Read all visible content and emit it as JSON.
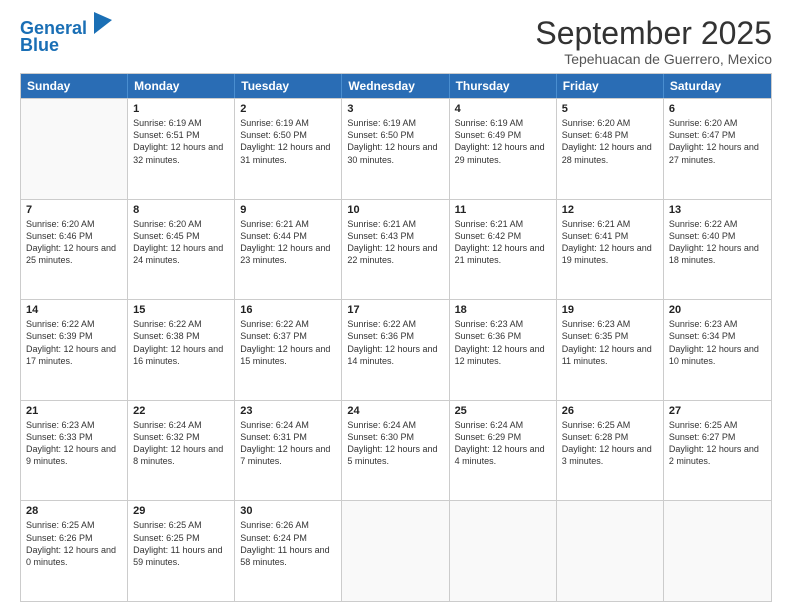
{
  "logo": {
    "line1": "General",
    "line2": "Blue"
  },
  "title": "September 2025",
  "subtitle": "Tepehuacan de Guerrero, Mexico",
  "headers": [
    "Sunday",
    "Monday",
    "Tuesday",
    "Wednesday",
    "Thursday",
    "Friday",
    "Saturday"
  ],
  "weeks": [
    [
      {
        "day": "",
        "sunrise": "",
        "sunset": "",
        "daylight": "",
        "empty": true
      },
      {
        "day": "1",
        "sunrise": "Sunrise: 6:19 AM",
        "sunset": "Sunset: 6:51 PM",
        "daylight": "Daylight: 12 hours and 32 minutes."
      },
      {
        "day": "2",
        "sunrise": "Sunrise: 6:19 AM",
        "sunset": "Sunset: 6:50 PM",
        "daylight": "Daylight: 12 hours and 31 minutes."
      },
      {
        "day": "3",
        "sunrise": "Sunrise: 6:19 AM",
        "sunset": "Sunset: 6:50 PM",
        "daylight": "Daylight: 12 hours and 30 minutes."
      },
      {
        "day": "4",
        "sunrise": "Sunrise: 6:19 AM",
        "sunset": "Sunset: 6:49 PM",
        "daylight": "Daylight: 12 hours and 29 minutes."
      },
      {
        "day": "5",
        "sunrise": "Sunrise: 6:20 AM",
        "sunset": "Sunset: 6:48 PM",
        "daylight": "Daylight: 12 hours and 28 minutes."
      },
      {
        "day": "6",
        "sunrise": "Sunrise: 6:20 AM",
        "sunset": "Sunset: 6:47 PM",
        "daylight": "Daylight: 12 hours and 27 minutes."
      }
    ],
    [
      {
        "day": "7",
        "sunrise": "Sunrise: 6:20 AM",
        "sunset": "Sunset: 6:46 PM",
        "daylight": "Daylight: 12 hours and 25 minutes."
      },
      {
        "day": "8",
        "sunrise": "Sunrise: 6:20 AM",
        "sunset": "Sunset: 6:45 PM",
        "daylight": "Daylight: 12 hours and 24 minutes."
      },
      {
        "day": "9",
        "sunrise": "Sunrise: 6:21 AM",
        "sunset": "Sunset: 6:44 PM",
        "daylight": "Daylight: 12 hours and 23 minutes."
      },
      {
        "day": "10",
        "sunrise": "Sunrise: 6:21 AM",
        "sunset": "Sunset: 6:43 PM",
        "daylight": "Daylight: 12 hours and 22 minutes."
      },
      {
        "day": "11",
        "sunrise": "Sunrise: 6:21 AM",
        "sunset": "Sunset: 6:42 PM",
        "daylight": "Daylight: 12 hours and 21 minutes."
      },
      {
        "day": "12",
        "sunrise": "Sunrise: 6:21 AM",
        "sunset": "Sunset: 6:41 PM",
        "daylight": "Daylight: 12 hours and 19 minutes."
      },
      {
        "day": "13",
        "sunrise": "Sunrise: 6:22 AM",
        "sunset": "Sunset: 6:40 PM",
        "daylight": "Daylight: 12 hours and 18 minutes."
      }
    ],
    [
      {
        "day": "14",
        "sunrise": "Sunrise: 6:22 AM",
        "sunset": "Sunset: 6:39 PM",
        "daylight": "Daylight: 12 hours and 17 minutes."
      },
      {
        "day": "15",
        "sunrise": "Sunrise: 6:22 AM",
        "sunset": "Sunset: 6:38 PM",
        "daylight": "Daylight: 12 hours and 16 minutes."
      },
      {
        "day": "16",
        "sunrise": "Sunrise: 6:22 AM",
        "sunset": "Sunset: 6:37 PM",
        "daylight": "Daylight: 12 hours and 15 minutes."
      },
      {
        "day": "17",
        "sunrise": "Sunrise: 6:22 AM",
        "sunset": "Sunset: 6:36 PM",
        "daylight": "Daylight: 12 hours and 14 minutes."
      },
      {
        "day": "18",
        "sunrise": "Sunrise: 6:23 AM",
        "sunset": "Sunset: 6:36 PM",
        "daylight": "Daylight: 12 hours and 12 minutes."
      },
      {
        "day": "19",
        "sunrise": "Sunrise: 6:23 AM",
        "sunset": "Sunset: 6:35 PM",
        "daylight": "Daylight: 12 hours and 11 minutes."
      },
      {
        "day": "20",
        "sunrise": "Sunrise: 6:23 AM",
        "sunset": "Sunset: 6:34 PM",
        "daylight": "Daylight: 12 hours and 10 minutes."
      }
    ],
    [
      {
        "day": "21",
        "sunrise": "Sunrise: 6:23 AM",
        "sunset": "Sunset: 6:33 PM",
        "daylight": "Daylight: 12 hours and 9 minutes."
      },
      {
        "day": "22",
        "sunrise": "Sunrise: 6:24 AM",
        "sunset": "Sunset: 6:32 PM",
        "daylight": "Daylight: 12 hours and 8 minutes."
      },
      {
        "day": "23",
        "sunrise": "Sunrise: 6:24 AM",
        "sunset": "Sunset: 6:31 PM",
        "daylight": "Daylight: 12 hours and 7 minutes."
      },
      {
        "day": "24",
        "sunrise": "Sunrise: 6:24 AM",
        "sunset": "Sunset: 6:30 PM",
        "daylight": "Daylight: 12 hours and 5 minutes."
      },
      {
        "day": "25",
        "sunrise": "Sunrise: 6:24 AM",
        "sunset": "Sunset: 6:29 PM",
        "daylight": "Daylight: 12 hours and 4 minutes."
      },
      {
        "day": "26",
        "sunrise": "Sunrise: 6:25 AM",
        "sunset": "Sunset: 6:28 PM",
        "daylight": "Daylight: 12 hours and 3 minutes."
      },
      {
        "day": "27",
        "sunrise": "Sunrise: 6:25 AM",
        "sunset": "Sunset: 6:27 PM",
        "daylight": "Daylight: 12 hours and 2 minutes."
      }
    ],
    [
      {
        "day": "28",
        "sunrise": "Sunrise: 6:25 AM",
        "sunset": "Sunset: 6:26 PM",
        "daylight": "Daylight: 12 hours and 0 minutes."
      },
      {
        "day": "29",
        "sunrise": "Sunrise: 6:25 AM",
        "sunset": "Sunset: 6:25 PM",
        "daylight": "Daylight: 11 hours and 59 minutes."
      },
      {
        "day": "30",
        "sunrise": "Sunrise: 6:26 AM",
        "sunset": "Sunset: 6:24 PM",
        "daylight": "Daylight: 11 hours and 58 minutes."
      },
      {
        "day": "",
        "sunrise": "",
        "sunset": "",
        "daylight": "",
        "empty": true
      },
      {
        "day": "",
        "sunrise": "",
        "sunset": "",
        "daylight": "",
        "empty": true
      },
      {
        "day": "",
        "sunrise": "",
        "sunset": "",
        "daylight": "",
        "empty": true
      },
      {
        "day": "",
        "sunrise": "",
        "sunset": "",
        "daylight": "",
        "empty": true
      }
    ]
  ]
}
